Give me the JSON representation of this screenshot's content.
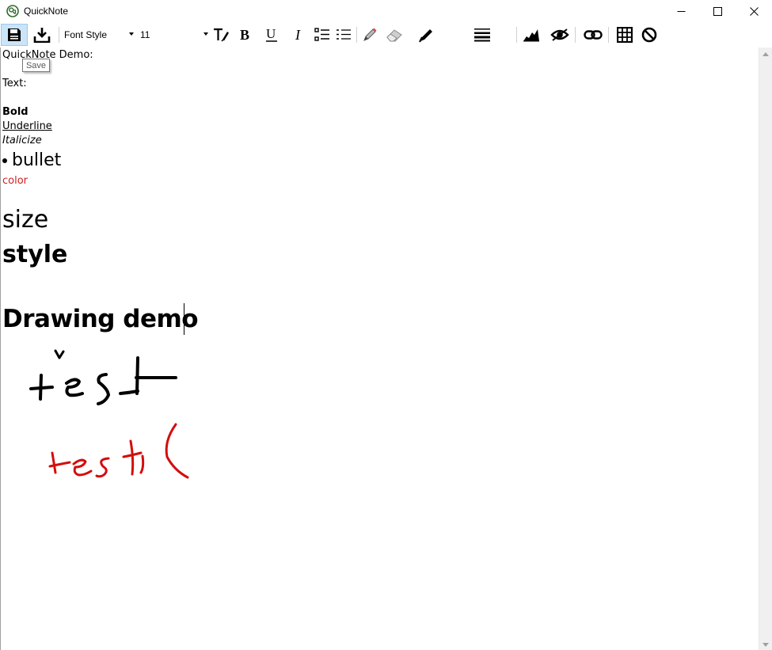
{
  "window": {
    "title": "QuickNote"
  },
  "toolbar": {
    "font_style_label": "Font Style",
    "font_size_value": "11",
    "tooltip": "Save",
    "icons": [
      "save-icon",
      "download-icon",
      "clear-format-icon",
      "bold-icon",
      "underline-icon",
      "italic-icon",
      "bullet-list-icon",
      "numbered-list-icon",
      "pencil-icon",
      "eraser-icon",
      "marker-icon",
      "line-width-icon",
      "chart-icon",
      "eye-icon",
      "link-icon",
      "grid-icon",
      "block-icon"
    ]
  },
  "document": {
    "line1": "QuickNote Demo:",
    "line2": "Text:",
    "bold": "Bold",
    "underline": "Underline",
    "italic": "Italicize",
    "bullet": "bullet",
    "color": "color",
    "size": "size",
    "style": "style",
    "heading": "Drawing demo"
  },
  "colors": {
    "text_red": "#d02020",
    "ink_black": "#000000",
    "ink_red": "#d40d0d",
    "save_highlight": "#cce4f7"
  }
}
